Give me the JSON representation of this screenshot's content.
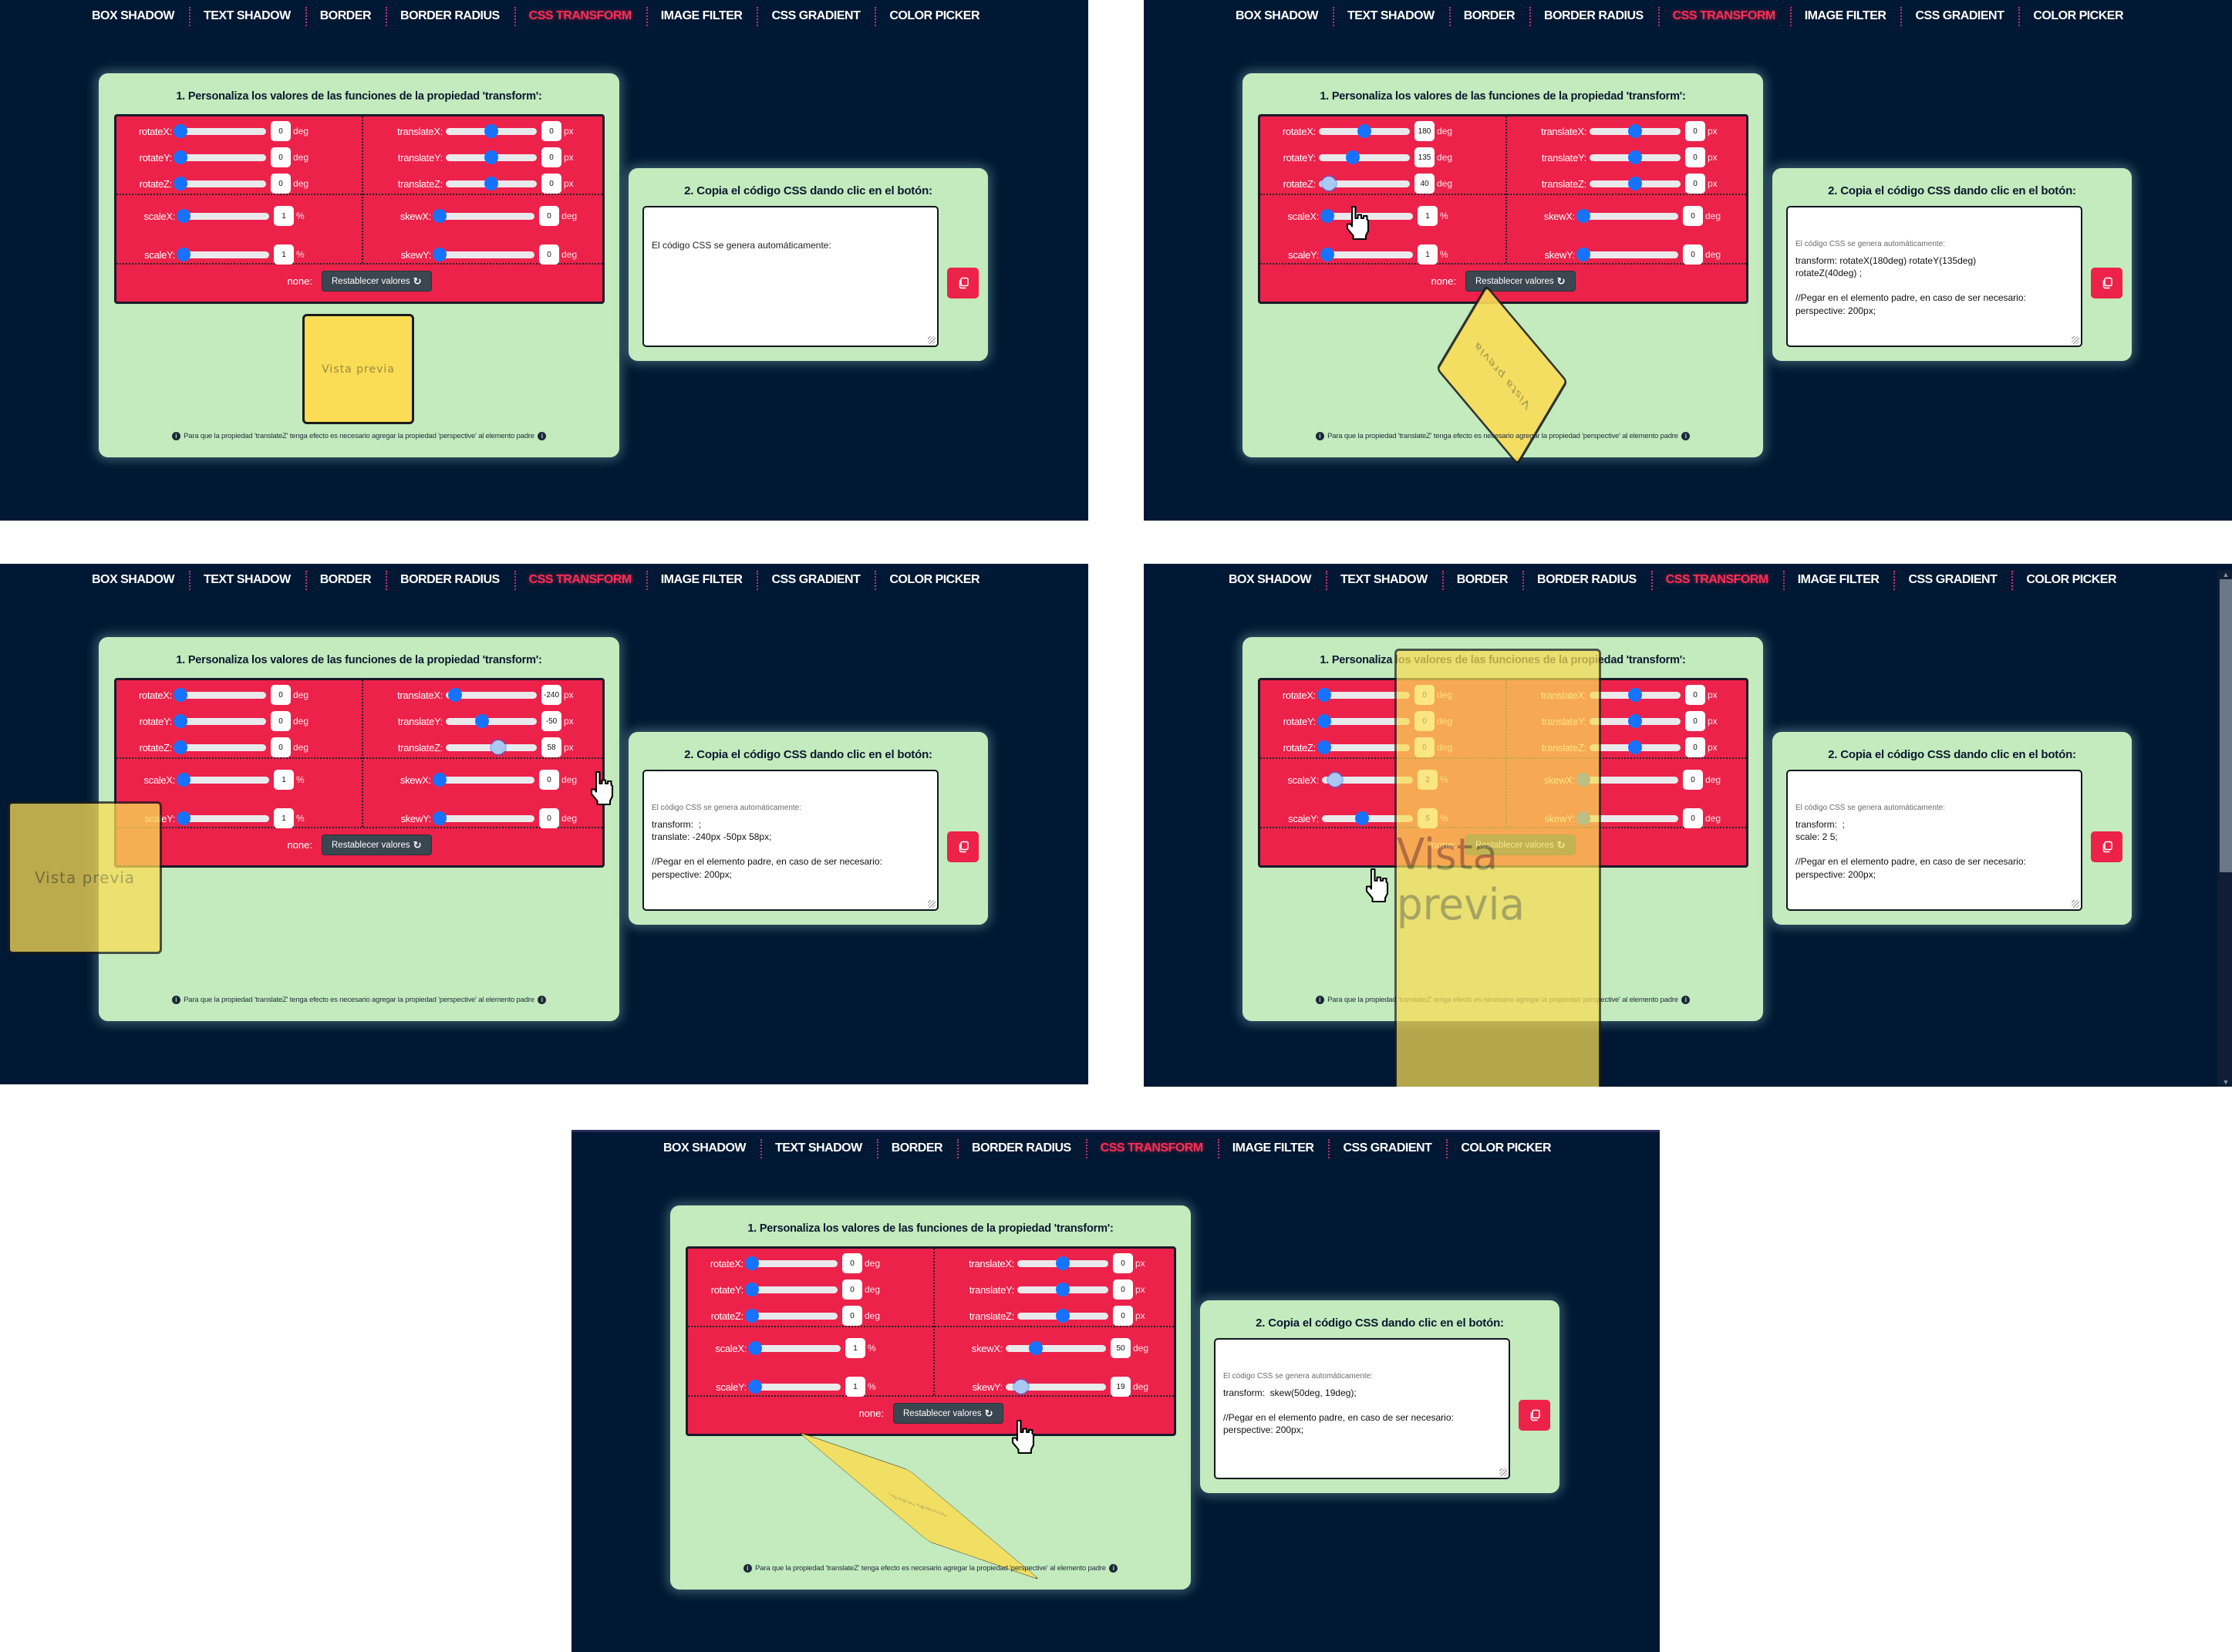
{
  "nav": {
    "items": [
      "BOX SHADOW",
      "TEXT SHADOW",
      "BORDER",
      "BORDER RADIUS",
      "CSS TRANSFORM",
      "IMAGE FILTER",
      "CSS GRADIENT",
      "COLOR PICKER"
    ],
    "active": "CSS TRANSFORM"
  },
  "common": {
    "step1_title": "1. Personaliza los valores de las funciones de la propiedad 'transform':",
    "step2_title": "2. Copia el código CSS dando clic en el botón:",
    "labels": {
      "rotateX": "rotateX:",
      "rotateY": "rotateY:",
      "rotateZ": "rotateZ:",
      "translateX": "translateX:",
      "translateY": "translateY:",
      "translateZ": "translateZ:",
      "scaleX": "scaleX:",
      "scaleY": "scaleY:",
      "skewX": "skewX:",
      "skewY": "skewY:"
    },
    "units": {
      "rotate": "deg",
      "translate": "px",
      "scale": "%",
      "skew": "deg"
    },
    "none_label": "none:",
    "reset_button": "Restablecer valores",
    "reset_icon": "↻",
    "preview_text": "Vista previa",
    "code_hint": "El código CSS se genera automáticamente:",
    "note": "Para que la propiedad 'translateZ' tenga efecto es necesario agregar la propiedad 'perspective' al elemento padre",
    "info_icon": "i",
    "copy_icon": "copy-icon"
  },
  "colors": {
    "background": "#001833",
    "card": "#c3ebbd",
    "controls": "#ec224b",
    "slider_thumb": "#1773ff",
    "nav_active": "#ff2d55",
    "preview": "#fadd55",
    "reset_button": "#3a4650"
  },
  "screens": [
    {
      "values": {
        "rotateX": "0",
        "rotateY": "0",
        "rotateZ": "0",
        "translateX": "0",
        "translateY": "0",
        "translateZ": "0",
        "scaleX": "1",
        "scaleY": "1",
        "skewX": "0",
        "skewY": "0"
      },
      "code_lines": []
    },
    {
      "values": {
        "rotateX": "180",
        "rotateY": "135",
        "rotateZ": "40",
        "translateX": "0",
        "translateY": "0",
        "translateZ": "0",
        "scaleX": "1",
        "scaleY": "1",
        "skewX": "0",
        "skewY": "0"
      },
      "code_lines": [
        "transform: rotateX(180deg) rotateY(135deg)",
        "rotateZ(40deg) ;",
        "",
        "//Pegar en el elemento padre, en caso de ser necesario:",
        "perspective: 200px;"
      ]
    },
    {
      "values": {
        "rotateX": "0",
        "rotateY": "0",
        "rotateZ": "0",
        "translateX": "-240",
        "translateY": "-50",
        "translateZ": "58",
        "scaleX": "1",
        "scaleY": "1",
        "skewX": "0",
        "skewY": "0"
      },
      "code_lines": [
        "transform:  ;",
        "translate: -240px -50px 58px;",
        "",
        "//Pegar en el elemento padre, en caso de ser necesario:",
        "perspective: 200px;"
      ]
    },
    {
      "values": {
        "rotateX": "0",
        "rotateY": "0",
        "rotateZ": "0",
        "translateX": "0",
        "translateY": "0",
        "translateZ": "0",
        "scaleX": "2",
        "scaleY": "5",
        "skewX": "0",
        "skewY": "0"
      },
      "code_lines": [
        "transform:  ;",
        "scale: 2 5;",
        "",
        "//Pegar en el elemento padre, en caso de ser necesario:",
        "perspective: 200px;"
      ]
    },
    {
      "values": {
        "rotateX": "0",
        "rotateY": "0",
        "rotateZ": "0",
        "translateX": "0",
        "translateY": "0",
        "translateZ": "0",
        "scaleX": "1",
        "scaleY": "1",
        "skewX": "50",
        "skewY": "19"
      },
      "code_lines": [
        "transform:  skew(50deg, 19deg);",
        "",
        "//Pegar en el elemento padre, en caso de ser necesario:",
        "perspective: 200px;"
      ]
    }
  ],
  "slider_positions": [
    {
      "rotateX": 0,
      "rotateY": 0,
      "rotateZ": 0,
      "translateX": 0.5,
      "translateY": 0.5,
      "translateZ": 0.5,
      "scaleX": 0,
      "scaleY": 0,
      "skewX": 0,
      "skewY": 0
    },
    {
      "rotateX": 0.5,
      "rotateY": 0.375,
      "rotateZ": 0.11,
      "translateX": 0.5,
      "translateY": 0.5,
      "translateZ": 0.5,
      "scaleX": 0,
      "scaleY": 0,
      "skewX": 0,
      "skewY": 0
    },
    {
      "rotateX": 0,
      "rotateY": 0,
      "rotateZ": 0,
      "translateX": 0.1,
      "translateY": 0.4,
      "translateZ": 0.58,
      "scaleX": 0,
      "scaleY": 0,
      "skewX": 0,
      "skewY": 0
    },
    {
      "rotateX": 0,
      "rotateY": 0,
      "rotateZ": 0,
      "translateX": 0.5,
      "translateY": 0.5,
      "translateZ": 0.5,
      "scaleX": 0.14,
      "scaleY": 0.44,
      "skewX": 0,
      "skewY": 0
    },
    {
      "rotateX": 0,
      "rotateY": 0,
      "rotateZ": 0,
      "translateX": 0.5,
      "translateY": 0.5,
      "translateZ": 0.5,
      "scaleX": 0,
      "scaleY": 0,
      "skewX": 0.3,
      "skewY": 0.15
    }
  ]
}
